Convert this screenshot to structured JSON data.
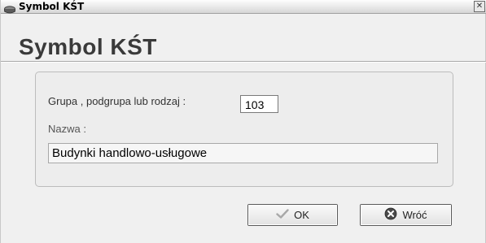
{
  "window": {
    "title": "Symbol KŚT",
    "close_glyph": "✕"
  },
  "heading": "Symbol KŚT",
  "form": {
    "group_label": "Grupa , podgrupa lub rodzaj  :",
    "group_value": "103",
    "name_label": "Nazwa  :",
    "name_value": "Budynki handlowo-usługowe"
  },
  "buttons": {
    "ok_label": "OK",
    "ok_icon": "checkmark-icon",
    "back_label": "Wróć",
    "back_icon": "cancel-circle-icon"
  },
  "colors": {
    "window_bg": "#f0f0f0",
    "panel_border": "#bcbcbc",
    "heading": "#3a3a3a"
  }
}
